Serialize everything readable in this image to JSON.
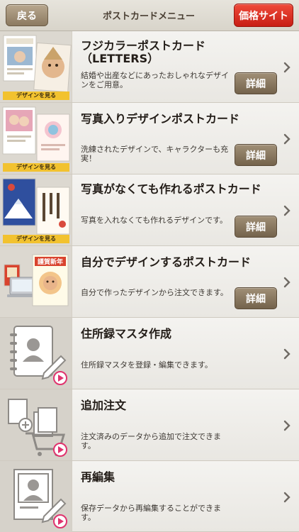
{
  "nav": {
    "back_label": "戻る",
    "title": "ポストカードメニュー",
    "price_label": "価格サイト"
  },
  "items": [
    {
      "title": "フジカラーポストカード（LETTERS）",
      "desc": "結婚や出産などにあったおしゃれなデザインをご用意。",
      "detail_label": "詳細",
      "badge": "デザインを見る"
    },
    {
      "title": "写真入りデザインポストカード",
      "desc": "洗練されたデザインで、キャラクターも充実！",
      "detail_label": "詳細",
      "badge": "デザインを見る"
    },
    {
      "title": "写真がなくても作れるポストカード",
      "desc": "写真を入れなくても作れるデザインです。",
      "detail_label": "詳細",
      "badge": "デザインを見る"
    },
    {
      "title": "自分でデザインするポストカード",
      "desc": "自分で作ったデザインから注文できます。",
      "detail_label": "詳細",
      "card_text": "謹賀新年"
    },
    {
      "title": "住所録マスタ作成",
      "desc": "住所録マスタを登録・編集できます。"
    },
    {
      "title": "追加注文",
      "desc": "注文済みのデータから追加で注文できます。"
    },
    {
      "title": "再編集",
      "desc": "保存データから再編集することができます。"
    }
  ],
  "colors": {
    "price_button": "#d92b1f",
    "detail_button": "#8a7960",
    "badge": "#f2c22f",
    "play_icon": "#e0336e"
  }
}
